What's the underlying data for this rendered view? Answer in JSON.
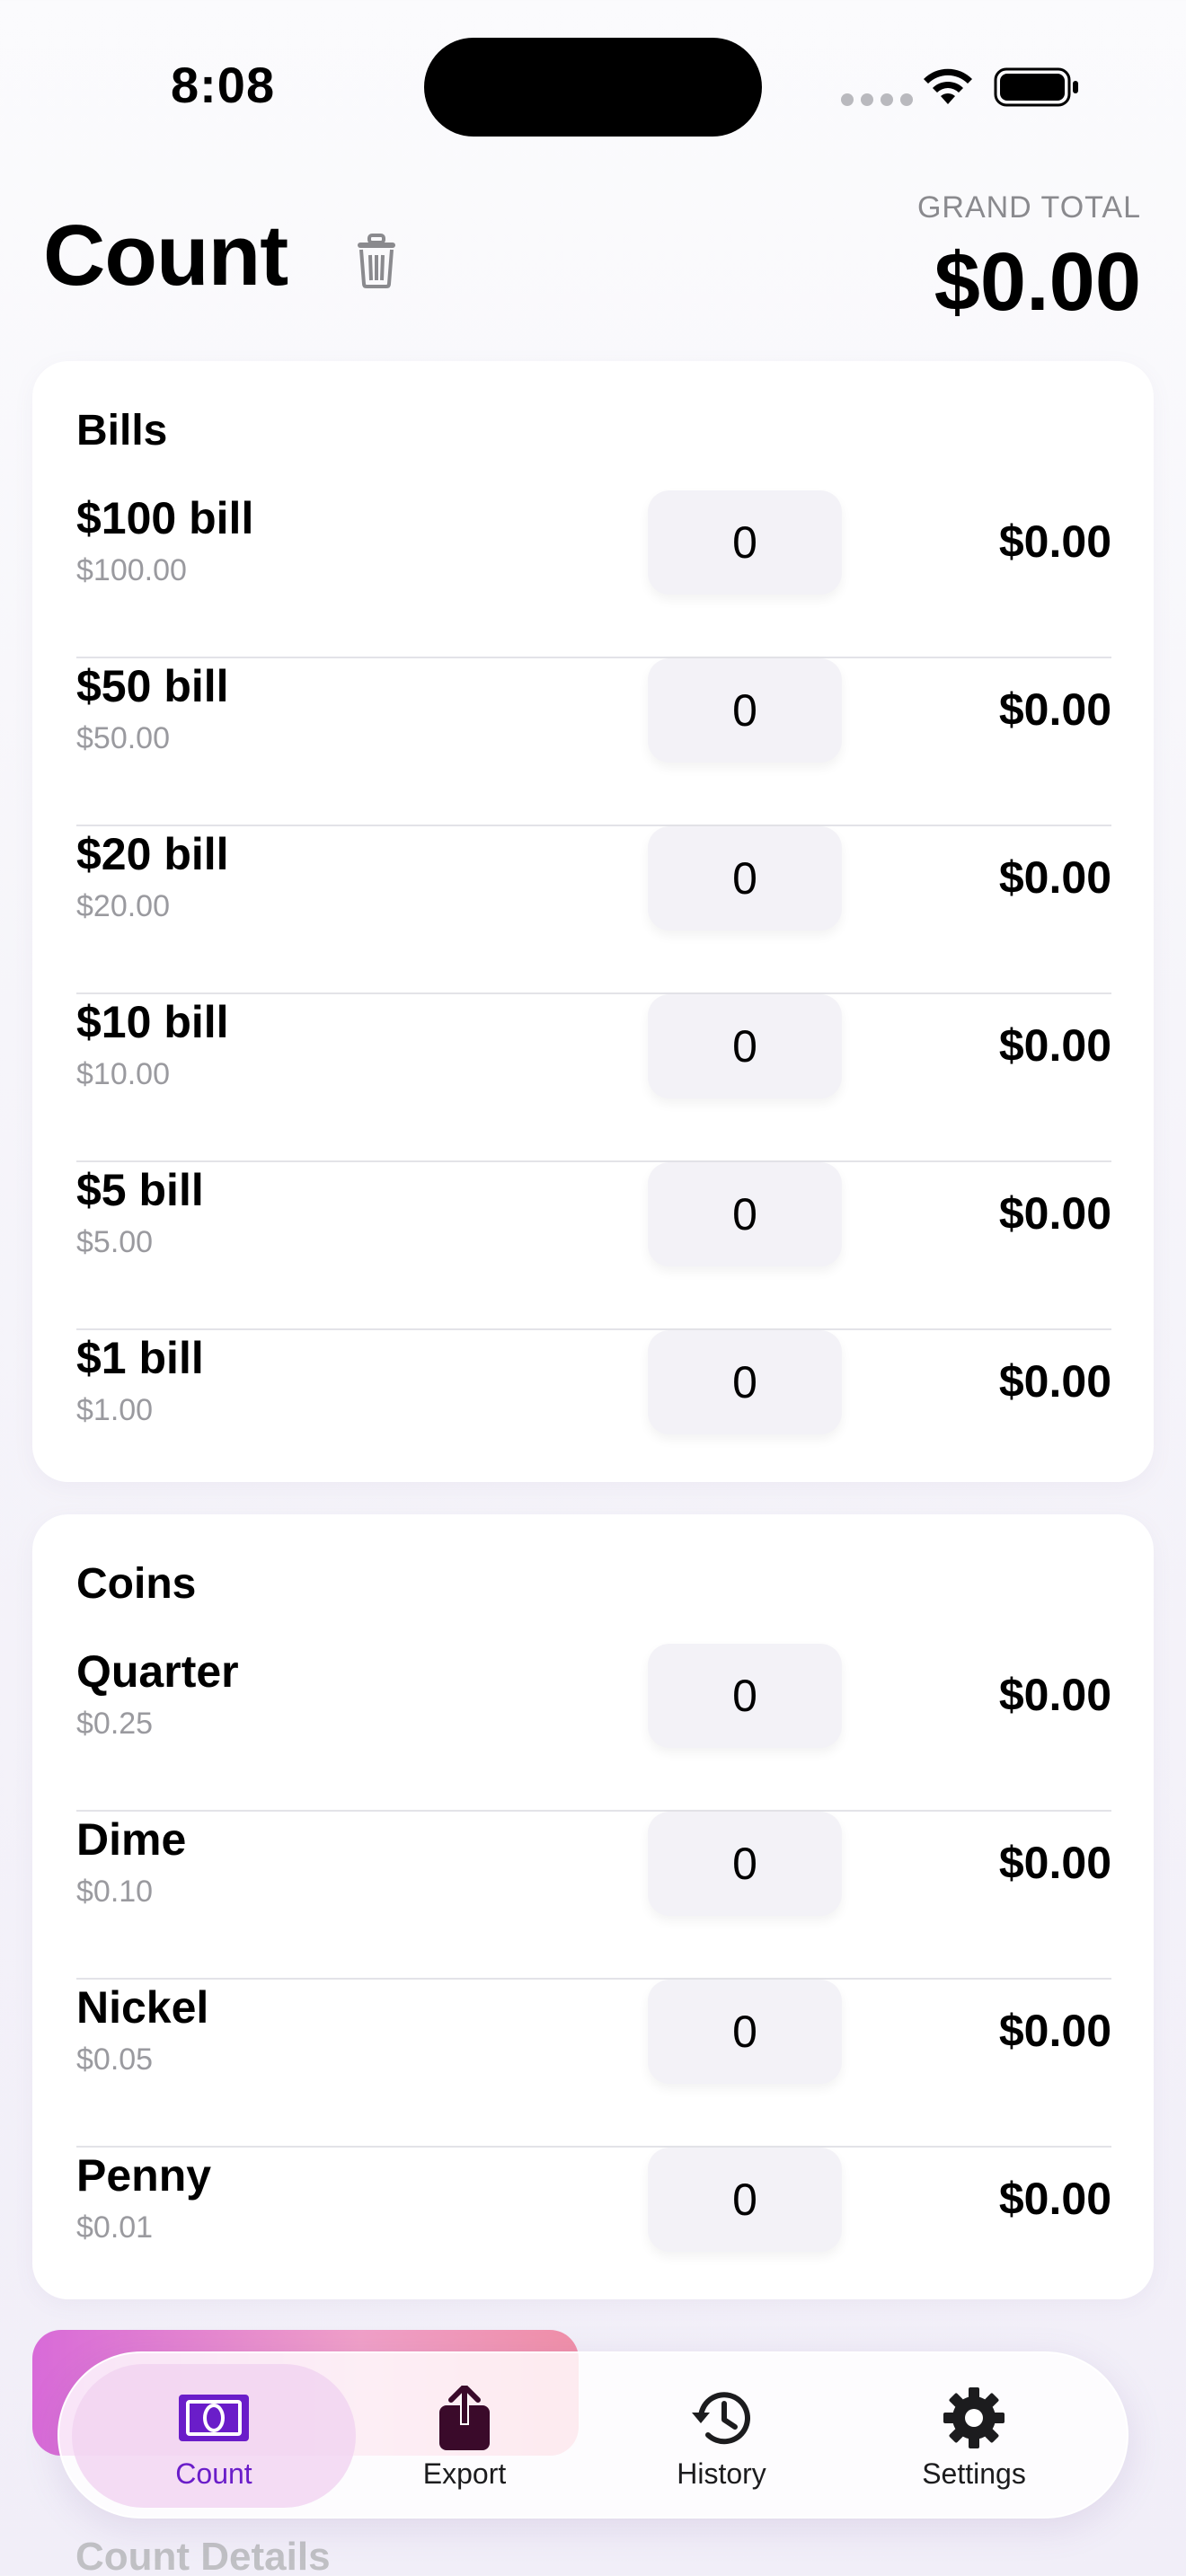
{
  "status_bar": {
    "time": "8:08"
  },
  "header": {
    "title": "Count",
    "grand_total_label": "GRAND TOTAL",
    "grand_total_value": "$0.00"
  },
  "bills": {
    "title": "Bills",
    "rows": [
      {
        "name": "$100 bill",
        "value": "$100.00",
        "count": "0",
        "total": "$0.00"
      },
      {
        "name": "$50 bill",
        "value": "$50.00",
        "count": "0",
        "total": "$0.00"
      },
      {
        "name": "$20 bill",
        "value": "$20.00",
        "count": "0",
        "total": "$0.00"
      },
      {
        "name": "$10 bill",
        "value": "$10.00",
        "count": "0",
        "total": "$0.00"
      },
      {
        "name": "$5 bill",
        "value": "$5.00",
        "count": "0",
        "total": "$0.00"
      },
      {
        "name": "$1 bill",
        "value": "$1.00",
        "count": "0",
        "total": "$0.00"
      }
    ]
  },
  "coins": {
    "title": "Coins",
    "rows": [
      {
        "name": "Quarter",
        "value": "$0.25",
        "count": "0",
        "total": "$0.00"
      },
      {
        "name": "Dime",
        "value": "$0.10",
        "count": "0",
        "total": "$0.00"
      },
      {
        "name": "Nickel",
        "value": "$0.05",
        "count": "0",
        "total": "$0.00"
      },
      {
        "name": "Penny",
        "value": "$0.01",
        "count": "0",
        "total": "$0.00"
      }
    ]
  },
  "below": {
    "count_details": "Count Details"
  },
  "tabs": [
    {
      "label": "Count",
      "icon": "banknote-icon",
      "active": true
    },
    {
      "label": "Export",
      "icon": "share-icon",
      "active": false
    },
    {
      "label": "History",
      "icon": "history-icon",
      "active": false
    },
    {
      "label": "Settings",
      "icon": "gear-icon",
      "active": false
    }
  ],
  "colors": {
    "accent": "#6a1dc9",
    "background": "#f6f5fa",
    "card": "#ffffff"
  }
}
